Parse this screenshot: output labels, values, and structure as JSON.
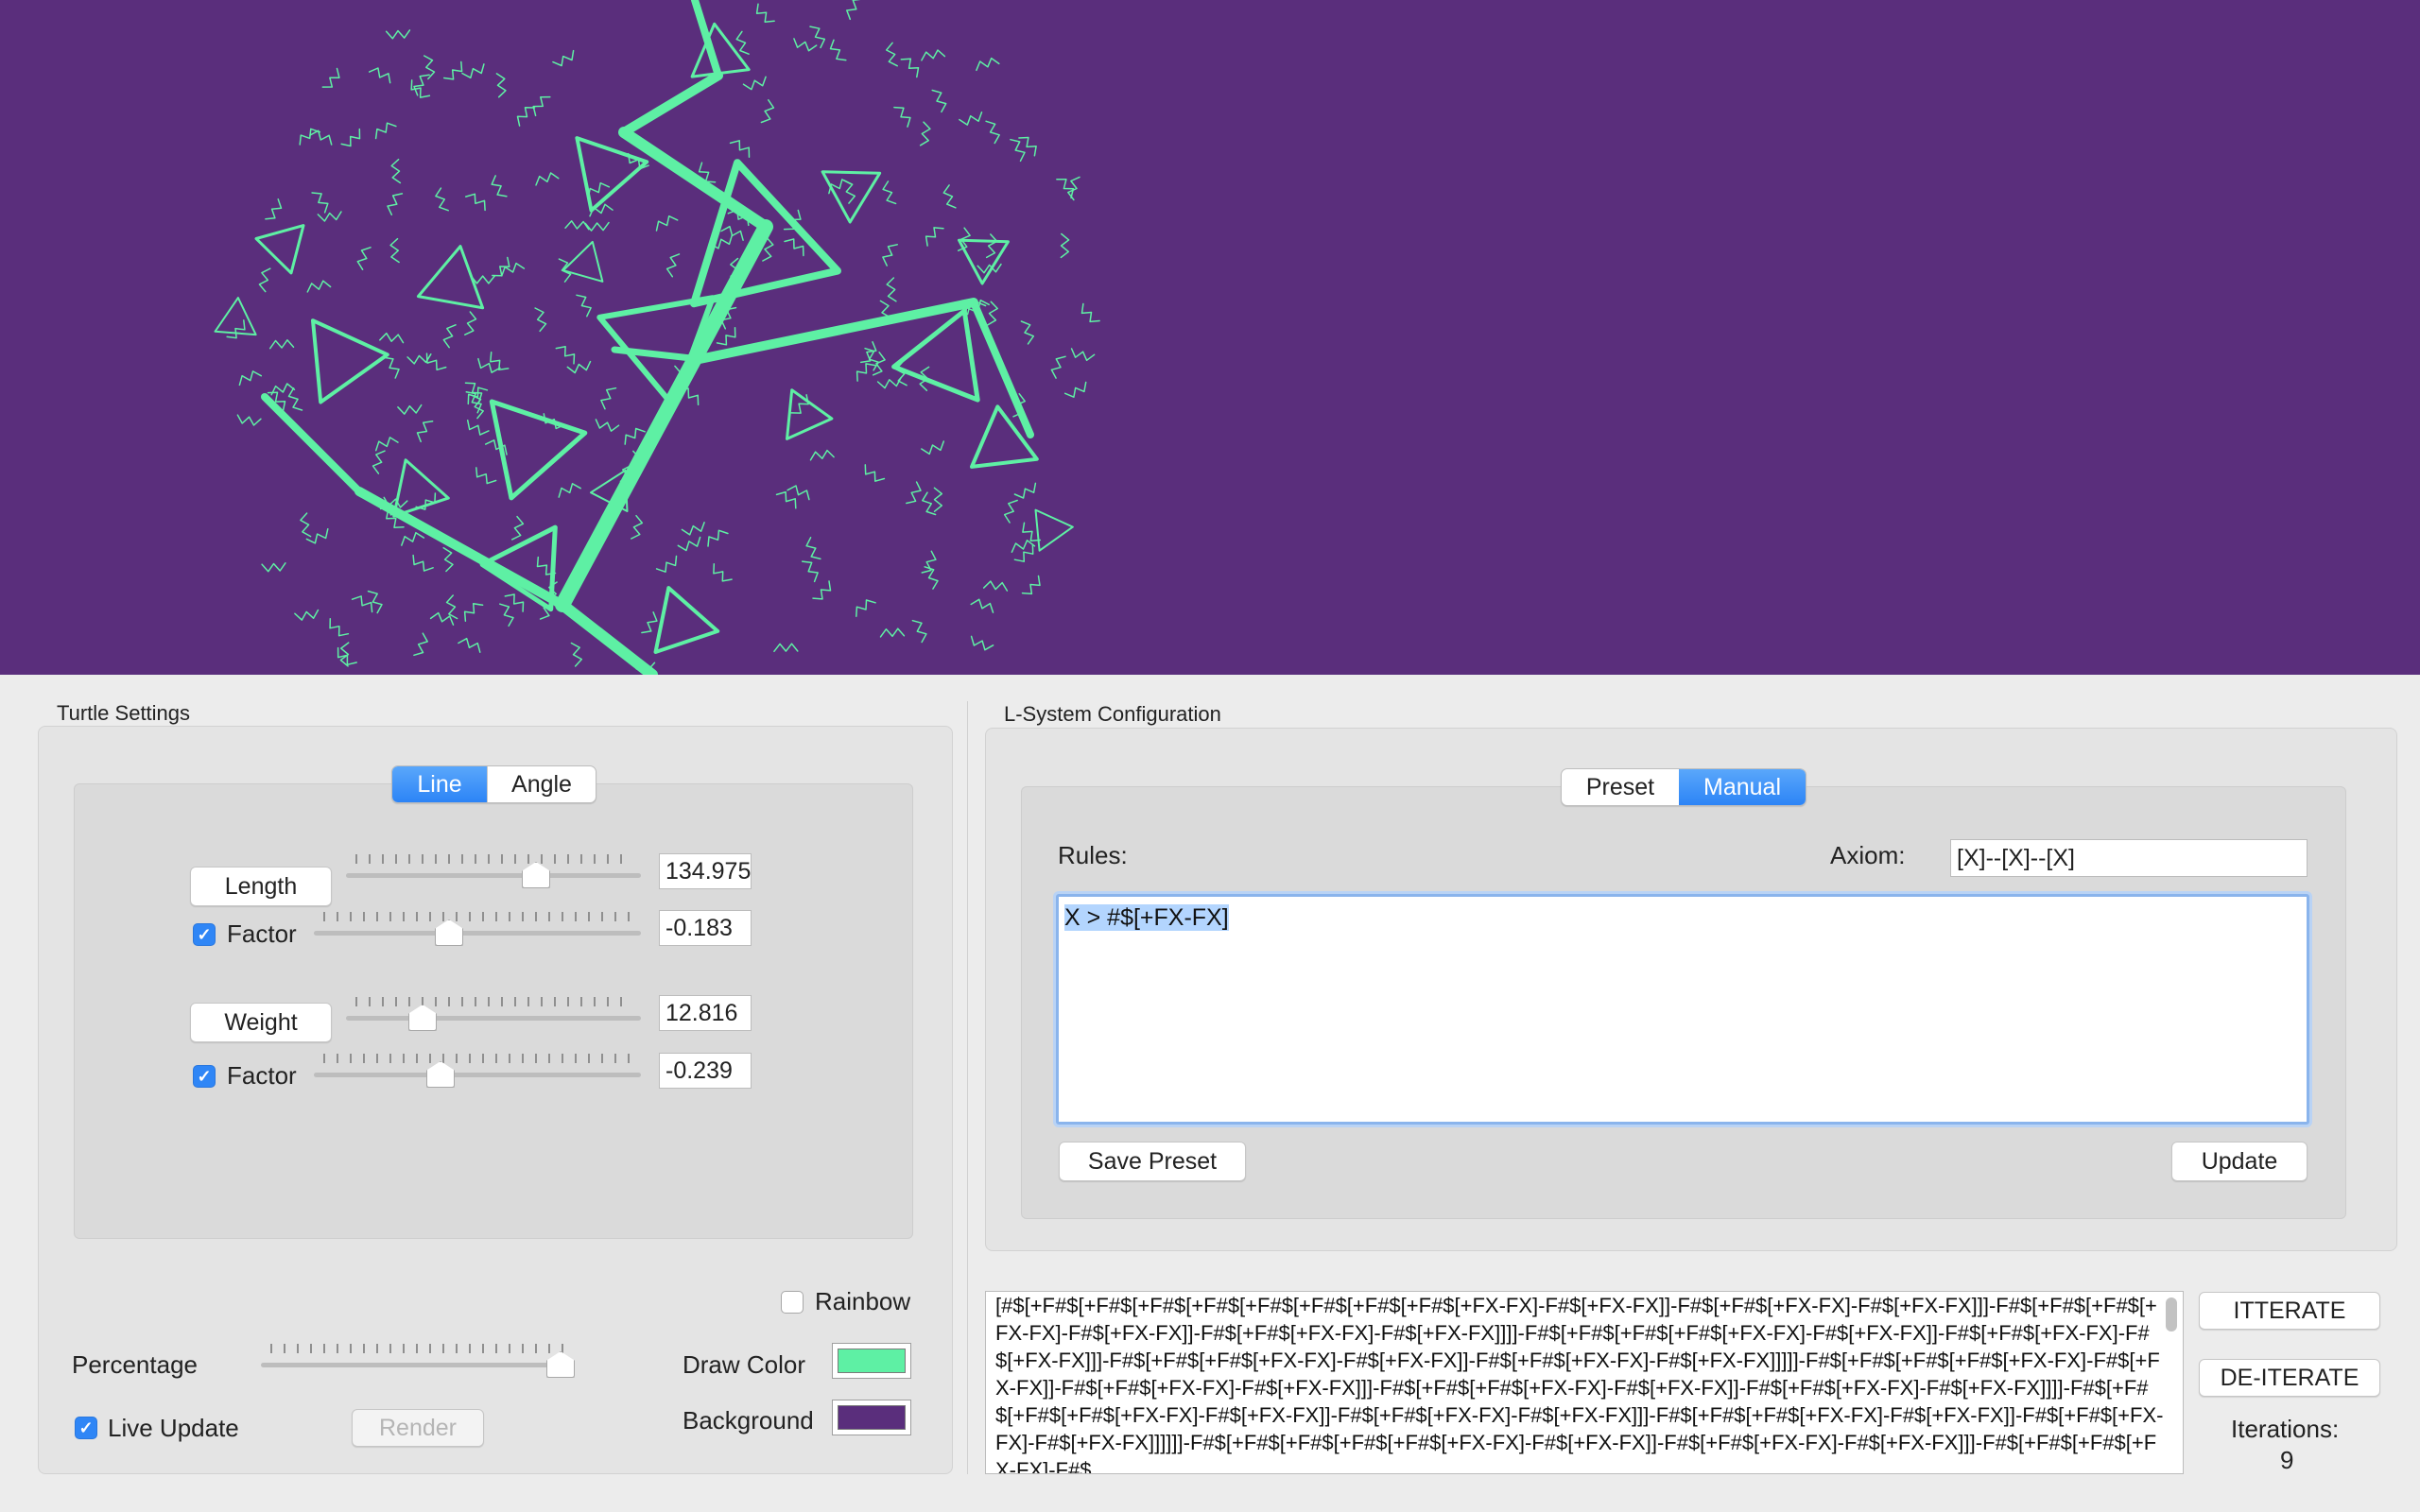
{
  "canvas": {
    "background": "#5a2e7c",
    "draw_color": "#5ef0a4"
  },
  "turtle": {
    "title": "Turtle Settings",
    "tabs": {
      "line": "Line",
      "angle": "Angle",
      "selected": "Line"
    },
    "length": {
      "button": "Length",
      "value": "134.975",
      "level": 0.6
    },
    "length_factor": {
      "label": "Factor",
      "checked": true,
      "value": "-0.183",
      "level": 0.42
    },
    "weight": {
      "button": "Weight",
      "value": "12.816",
      "level": 0.25
    },
    "weight_factor": {
      "label": "Factor",
      "checked": true,
      "value": "-0.239",
      "level": 0.38
    },
    "rainbow": {
      "label": "Rainbow",
      "checked": false
    },
    "percentage": {
      "label": "Percentage",
      "level": 1.0
    },
    "draw_color": {
      "label": "Draw Color",
      "color": "#5ef0a4"
    },
    "background": {
      "label": "Background",
      "color": "#5a2e7c"
    },
    "live_update": {
      "label": "Live Update",
      "checked": true
    },
    "render": "Render"
  },
  "lsystem": {
    "title": "L-System Configuration",
    "tabs": {
      "preset": "Preset",
      "manual": "Manual",
      "selected": "Manual"
    },
    "rules_label": "Rules:",
    "axiom_label": "Axiom:",
    "axiom_value": "[X]--[X]--[X]",
    "rules_value": "X > #$[+FX-FX]",
    "save_preset": "Save Preset",
    "update": "Update"
  },
  "output": {
    "text": "[#$[+F#$[+F#$[+F#$[+F#$[+F#$[+F#$[+F#$[+F#$[+FX-FX]-F#$[+FX-FX]]-F#$[+F#$[+FX-FX]-F#$[+FX-FX]]]-F#$[+F#$[+F#$[+FX-FX]-F#$[+FX-FX]]-F#$[+F#$[+FX-FX]-F#$[+FX-FX]]]]-F#$[+F#$[+F#$[+F#$[+FX-FX]-F#$[+FX-FX]]-F#$[+F#$[+FX-FX]-F#$[+FX-FX]]]-F#$[+F#$[+F#$[+FX-FX]-F#$[+FX-FX]]-F#$[+F#$[+FX-FX]-F#$[+FX-FX]]]]]-F#$[+F#$[+F#$[+F#$[+FX-FX]-F#$[+FX-FX]]-F#$[+F#$[+FX-FX]-F#$[+FX-FX]]]-F#$[+F#$[+F#$[+FX-FX]-F#$[+FX-FX]]-F#$[+F#$[+FX-FX]-F#$[+FX-FX]]]]-F#$[+F#$[+F#$[+F#$[+FX-FX]-F#$[+FX-FX]]-F#$[+F#$[+FX-FX]-F#$[+FX-FX]]]-F#$[+F#$[+F#$[+FX-FX]-F#$[+FX-FX]]-F#$[+F#$[+FX-FX]-F#$[+FX-FX]]]]]]-F#$[+F#$[+F#$[+F#$[+F#$[+FX-FX]-F#$[+FX-FX]]-F#$[+F#$[+FX-FX]-F#$[+FX-FX]]]-F#$[+F#$[+F#$[+FX-FX]-F#$",
    "iterate": "ITTERATE",
    "deiterate": "DE-ITERATE",
    "iterations_label": "Iterations:",
    "iterations_value": "9"
  }
}
